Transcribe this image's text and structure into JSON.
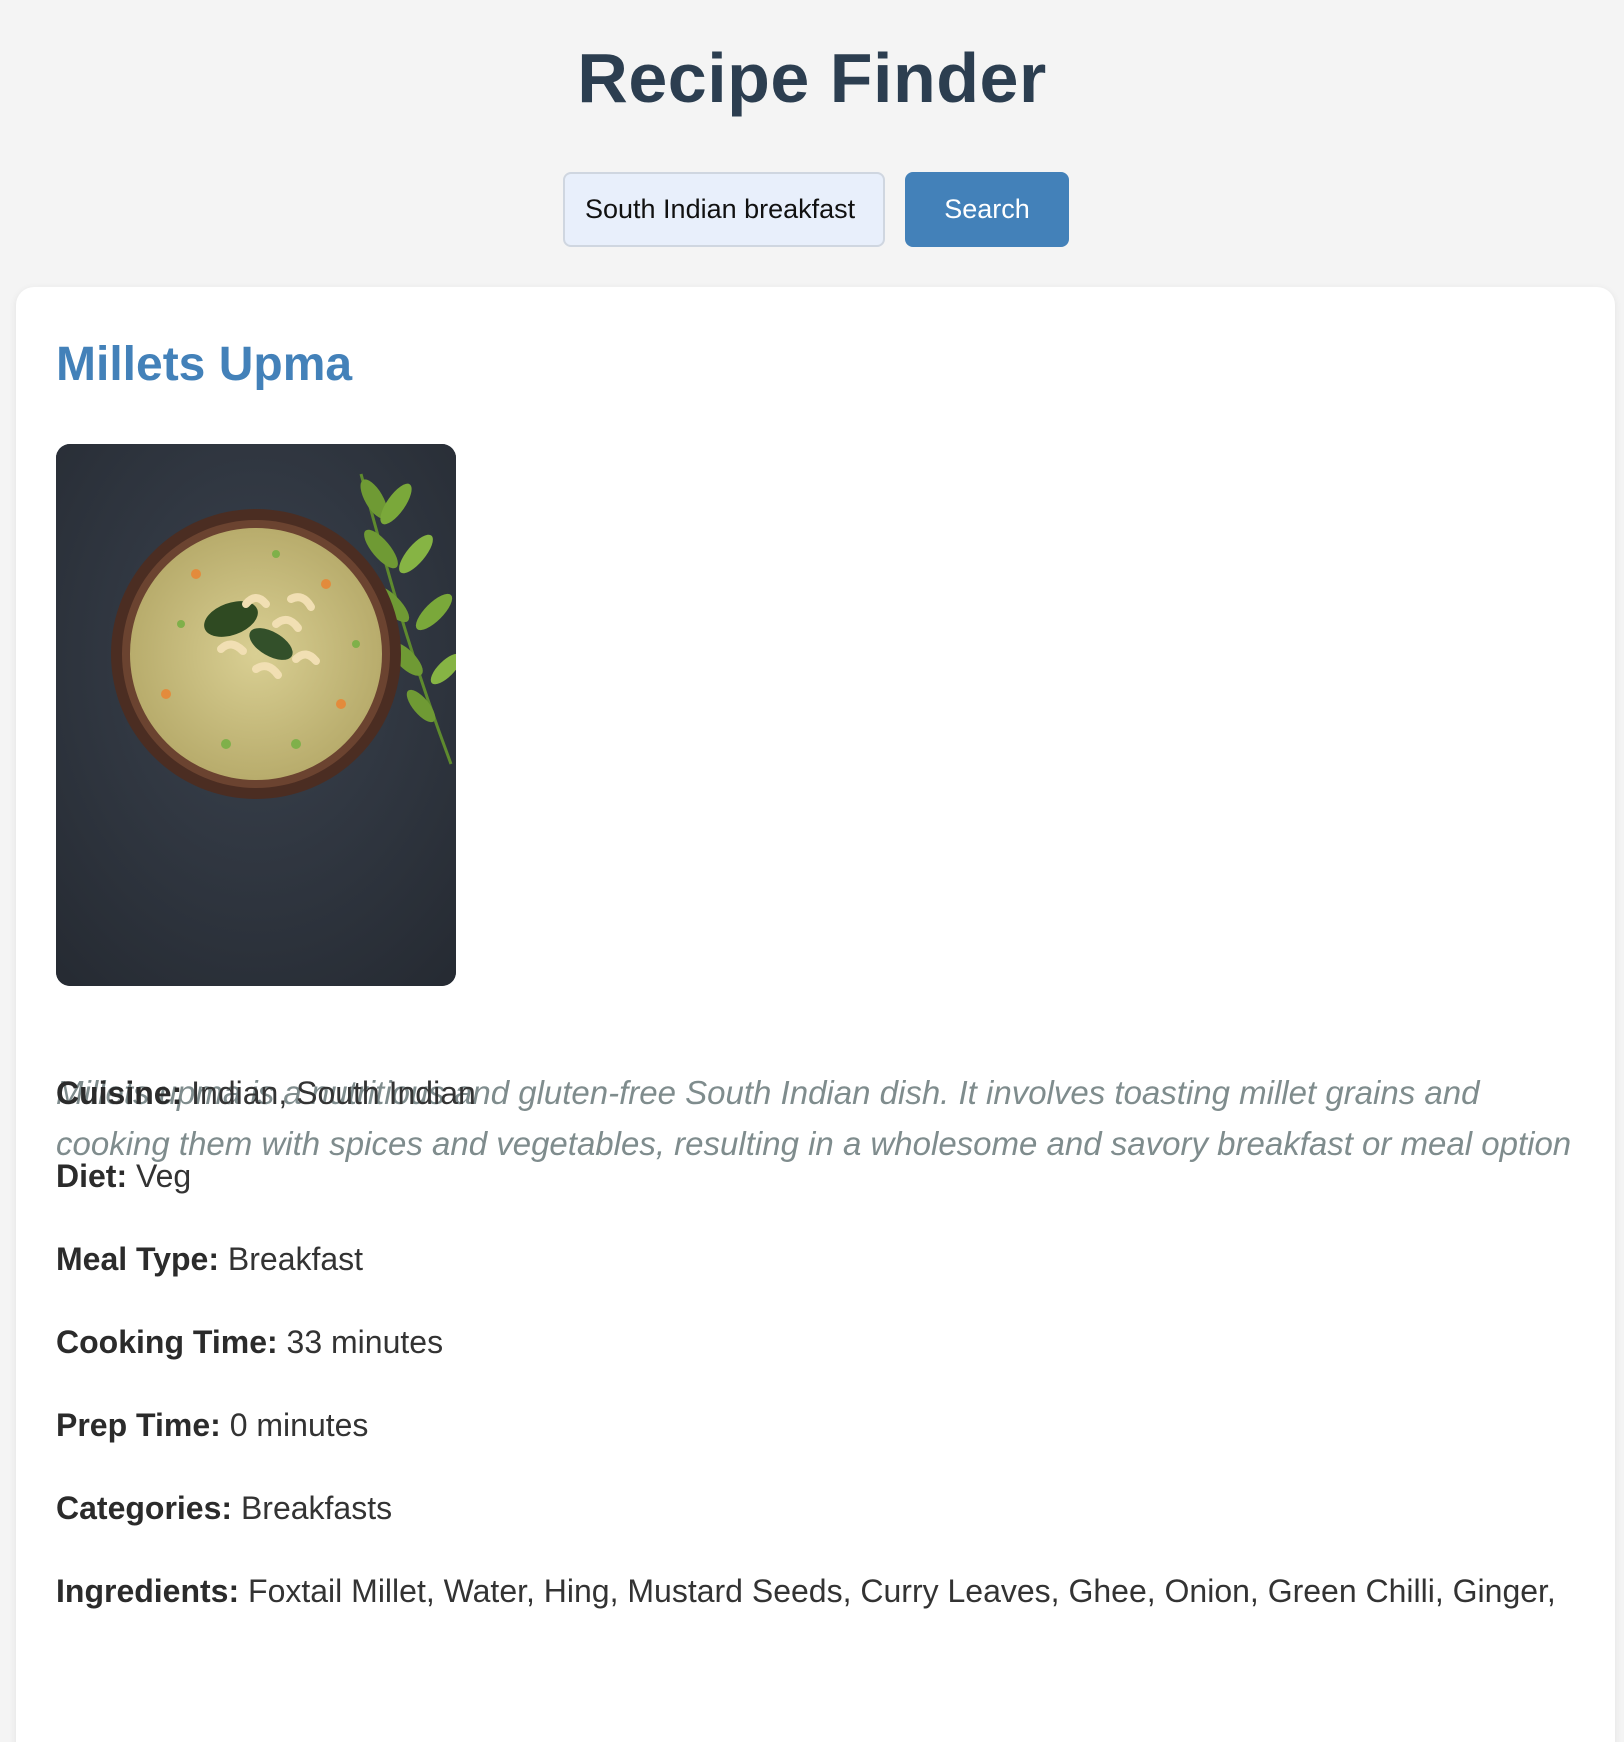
{
  "app": {
    "title": "Recipe Finder"
  },
  "search": {
    "value": "South Indian breakfast i",
    "button_label": "Search"
  },
  "recipe": {
    "title": "Millets Upma",
    "image_icon": "food-photo-icon",
    "description": "Millets upma is a nutritious and gluten-free South Indian dish. It involves toasting millet grains and cooking them with spices and vegetables, resulting in a wholesome and savory breakfast or meal option",
    "details": [
      {
        "label": "Cuisine:",
        "value": "Indian, South Indian"
      },
      {
        "label": "Diet:",
        "value": "Veg"
      },
      {
        "label": "Meal Type:",
        "value": "Breakfast"
      },
      {
        "label": "Cooking Time:",
        "value": "33 minutes"
      },
      {
        "label": "Prep Time:",
        "value": "0 minutes"
      },
      {
        "label": "Categories:",
        "value": "Breakfasts"
      },
      {
        "label": "Ingredients:",
        "value": "Foxtail Millet, Water, Hing, Mustard Seeds, Curry Leaves, Ghee, Onion, Green Chilli, Ginger,"
      }
    ]
  },
  "colors": {
    "accent": "#4381b9",
    "heading": "#2c3e50",
    "description": "#7f8c8d",
    "background": "#f4f4f4"
  }
}
